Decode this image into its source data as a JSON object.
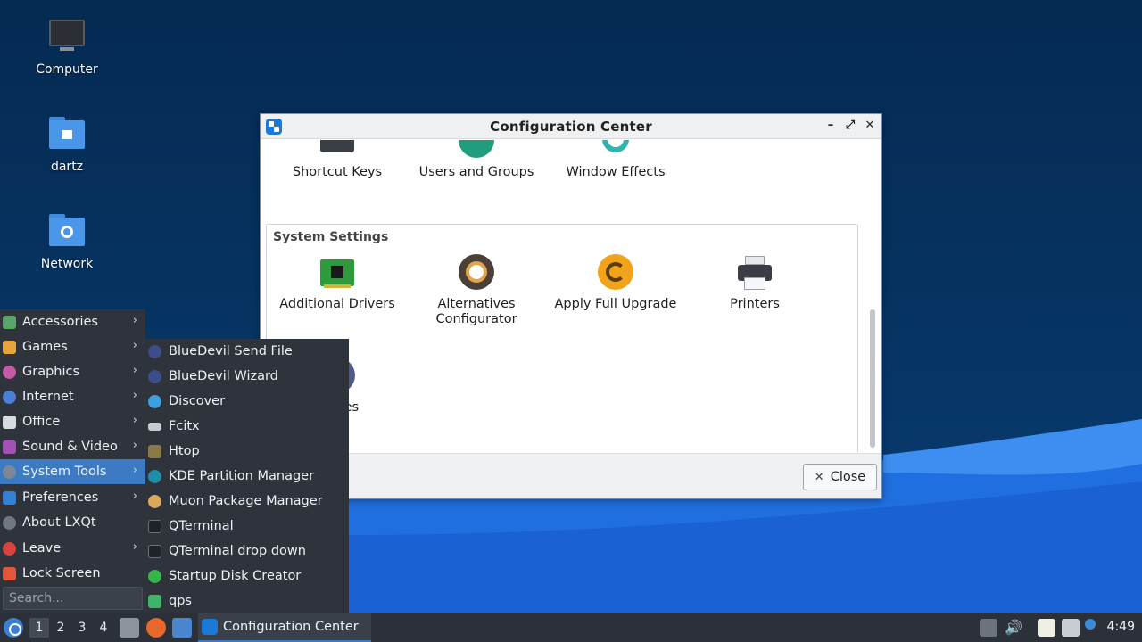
{
  "desktop": {
    "icons": [
      {
        "label": "Computer"
      },
      {
        "label": "dartz"
      },
      {
        "label": "Network"
      }
    ]
  },
  "window": {
    "title": "Configuration Center",
    "top_items": [
      {
        "label": "Shortcut Keys"
      },
      {
        "label": "Users and Groups"
      },
      {
        "label": "Window Effects"
      }
    ],
    "group_title": "System Settings",
    "system_items": [
      {
        "label": "Additional Drivers"
      },
      {
        "label": "Alternatives Configurator"
      },
      {
        "label": "Apply Full Upgrade"
      },
      {
        "label": "Printers"
      }
    ],
    "partial_item_label": "ources",
    "close_label": "Close"
  },
  "menu": {
    "items": [
      {
        "label": "Accessories"
      },
      {
        "label": "Games"
      },
      {
        "label": "Graphics"
      },
      {
        "label": "Internet"
      },
      {
        "label": "Office"
      },
      {
        "label": "Sound & Video"
      },
      {
        "label": "System Tools"
      },
      {
        "label": "Preferences"
      },
      {
        "label": "About LXQt"
      },
      {
        "label": "Leave"
      },
      {
        "label": "Lock Screen"
      }
    ],
    "search_placeholder": "Search..."
  },
  "submenu": {
    "items": [
      {
        "label": "BlueDevil Send File"
      },
      {
        "label": "BlueDevil Wizard"
      },
      {
        "label": "Discover"
      },
      {
        "label": "Fcitx"
      },
      {
        "label": "Htop"
      },
      {
        "label": "KDE Partition Manager"
      },
      {
        "label": "Muon Package Manager"
      },
      {
        "label": "QTerminal"
      },
      {
        "label": "QTerminal drop down"
      },
      {
        "label": "Startup Disk Creator"
      },
      {
        "label": "qps"
      }
    ]
  },
  "taskbar": {
    "workspaces": [
      "1",
      "2",
      "3",
      "4"
    ],
    "task_label": "Configuration Center",
    "clock": "4:49"
  }
}
